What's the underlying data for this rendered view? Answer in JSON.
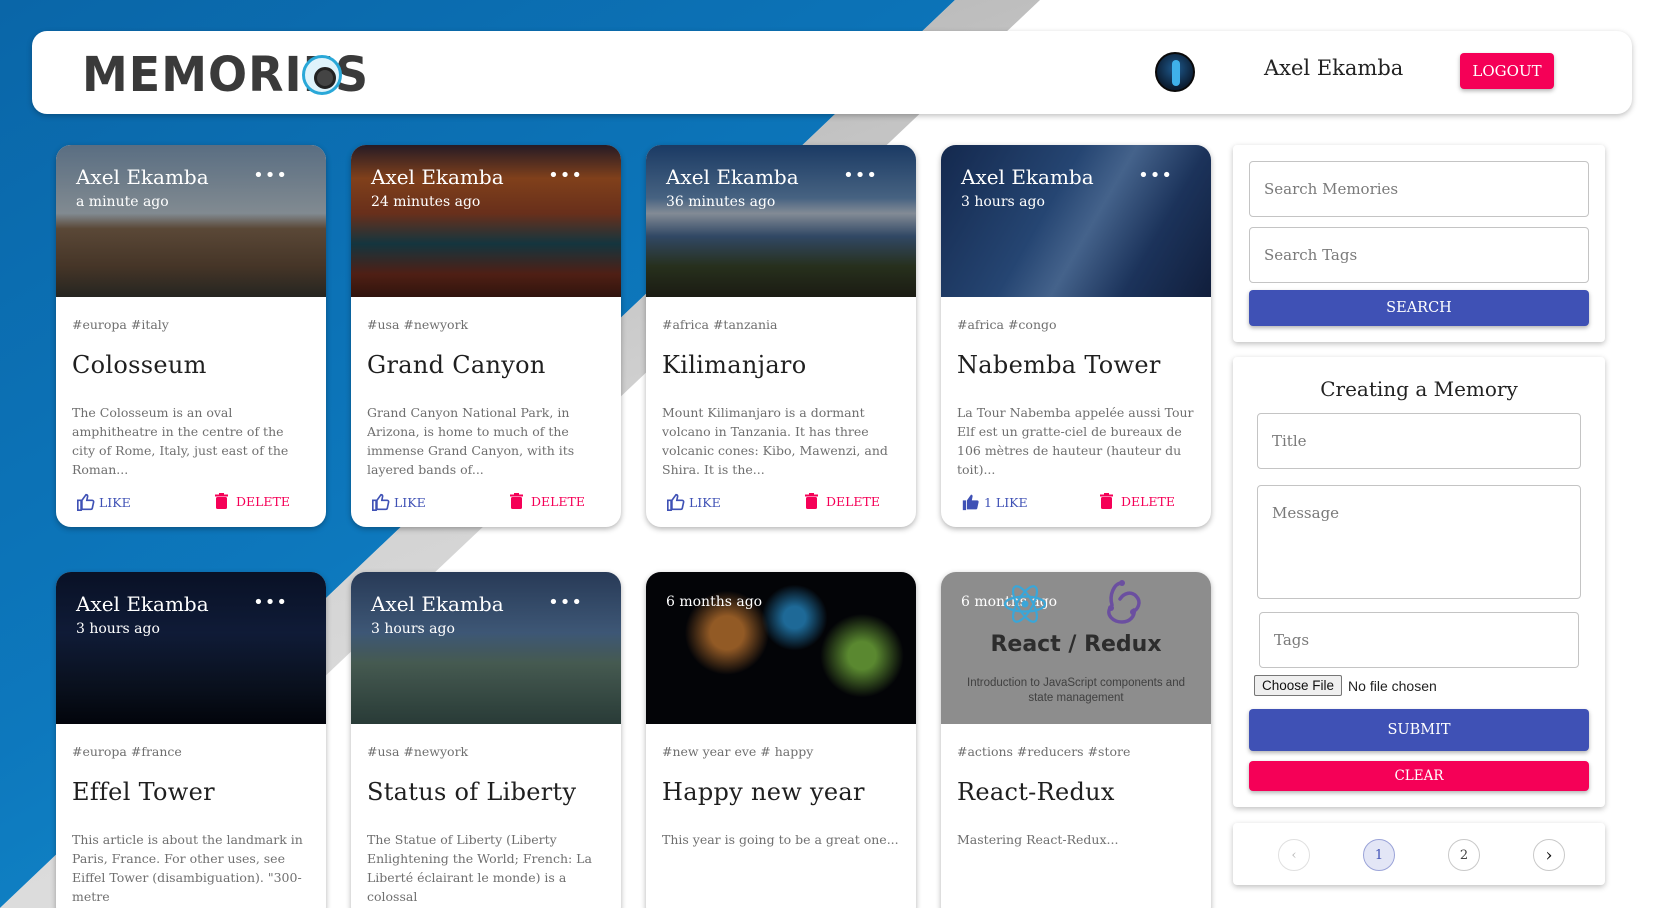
{
  "header": {
    "brand": "MEMORIES",
    "username": "Axel Ekamba",
    "logout_label": "LOGOUT"
  },
  "posts": [
    {
      "author": "Axel Ekamba",
      "time": "a minute ago",
      "tags": "#europa #italy",
      "title": "Colosseum",
      "message": "The Colosseum is an oval amphitheatre in the centre of the city of Rome, Italy, just east of the Roman...",
      "like_label": "LIKE",
      "delete_label": "DELETE"
    },
    {
      "author": "Axel Ekamba",
      "time": "24 minutes ago",
      "tags": "#usa #newyork",
      "title": "Grand Canyon",
      "message": "Grand Canyon National Park, in Arizona, is home to much of the immense Grand Canyon, with its layered bands of...",
      "like_label": "LIKE",
      "delete_label": "DELETE"
    },
    {
      "author": "Axel Ekamba",
      "time": "36 minutes ago",
      "tags": "#africa #tanzania",
      "title": "Kilimanjaro",
      "message": "Mount Kilimanjaro is a dormant volcano in Tanzania. It has three volcanic cones: Kibo, Mawenzi, and Shira. It is the...",
      "like_label": "LIKE",
      "delete_label": "DELETE"
    },
    {
      "author": "Axel Ekamba",
      "time": "3 hours ago",
      "tags": "#africa #congo",
      "title": "Nabemba Tower",
      "message": "La Tour Nabemba appelée aussi Tour Elf est un gratte-ciel de bureaux de 106 mètres de hauteur (hauteur du toit)...",
      "like_label": "1 LIKE",
      "delete_label": "DELETE"
    },
    {
      "author": "Axel Ekamba",
      "time": "3 hours ago",
      "tags": "#europa #france",
      "title": "Effel Tower",
      "message": "This article is about the landmark in Paris, France. For other uses, see Eiffel Tower (disambiguation). \"300-metre"
    },
    {
      "author": "Axel Ekamba",
      "time": "3 hours ago",
      "tags": "#usa #newyork",
      "title": "Status of Liberty",
      "message": "The Statue of Liberty (Liberty Enlightening the World; French: La Liberté éclairant le monde) is a colossal"
    },
    {
      "author": "",
      "time": "6 months ago",
      "tags": "#new year eve # happy",
      "title": "Happy new year",
      "message": "This year is going to be a great one..."
    },
    {
      "author": "",
      "time": "6 months ago",
      "tags": "#actions #reducers #store",
      "title": "React-Redux",
      "message": "Mastering React-Redux...",
      "media_title": "React / Redux",
      "media_subtitle": "Introduction to JavaScript components and state management"
    }
  ],
  "search": {
    "memories_placeholder": "Search Memories",
    "tags_placeholder": "Search Tags",
    "button_label": "SEARCH"
  },
  "form": {
    "heading": "Creating a Memory",
    "title_placeholder": "Title",
    "message_placeholder": "Message",
    "tags_placeholder": "Tags",
    "file_button": "Choose File",
    "file_status": "No file chosen",
    "submit_label": "SUBMIT",
    "clear_label": "CLEAR"
  },
  "pagination": {
    "pages": [
      "1",
      "2"
    ],
    "current": "1"
  },
  "colors": {
    "primary": "#3f51b5",
    "secondary": "#f50057"
  }
}
